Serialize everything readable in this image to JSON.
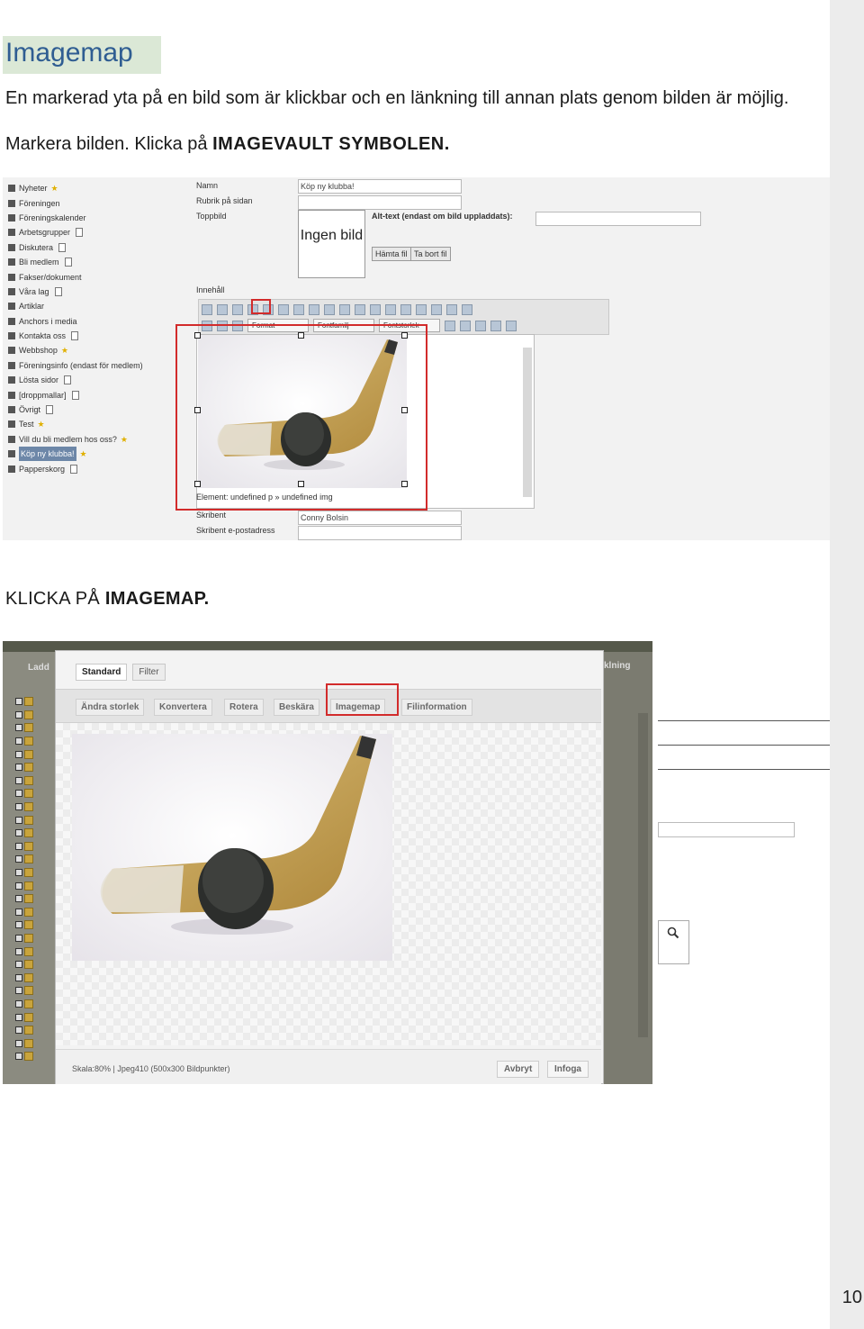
{
  "heading": "Imagemap",
  "para1": "En markerad yta på en bild som är klickbar och en länkning till annan plats genom bilden är möjlig.",
  "para2_prefix": "Markera bilden. Klicka på ",
  "para2_bold": "IMAGEVAULT SYMBOLEN.",
  "para3_prefix": "KLICKA PÅ ",
  "para3_bold": "IMAGEMAP.",
  "page_number": "10",
  "shot1": {
    "tree": [
      {
        "label": "Nyheter",
        "icon": "star"
      },
      {
        "label": "Föreningen",
        "icon": "none"
      },
      {
        "label": "Föreningskalender",
        "icon": "none"
      },
      {
        "label": "Arbetsgrupper",
        "icon": "doc"
      },
      {
        "label": "Diskutera",
        "icon": "doc"
      },
      {
        "label": "Bli medlem",
        "icon": "doc"
      },
      {
        "label": "Fakser/dokument",
        "icon": "none"
      },
      {
        "label": "Våra lag",
        "icon": "doc"
      },
      {
        "label": "Artiklar",
        "icon": "none"
      },
      {
        "label": "Anchors i media",
        "icon": "none"
      },
      {
        "label": "Kontakta oss",
        "icon": "doc"
      },
      {
        "label": "Webbshop",
        "icon": "star"
      },
      {
        "label": "Föreningsinfo (endast för medlem)",
        "icon": "none"
      },
      {
        "label": "Lösta sidor",
        "icon": "doc"
      },
      {
        "label": "[droppmallar]",
        "icon": "doc"
      },
      {
        "label": "Övrigt",
        "icon": "doc"
      },
      {
        "label": "Test",
        "icon": "star"
      },
      {
        "label": "Vill du bli medlem hos oss?",
        "icon": "star"
      },
      {
        "label": "Köp ny klubba!",
        "icon": "star",
        "selected": true
      },
      {
        "label": "Papperskorg",
        "icon": "doc"
      }
    ],
    "labels": {
      "name": "Namn",
      "page_heading": "Rubrik på sidan",
      "top_image": "Toppbild",
      "content": "Innehåll",
      "alt_text": "Alt-text (endast om bild uppladdats):",
      "writer": "Skribent",
      "writer_email": "Skribent e-postadress"
    },
    "values": {
      "name": "Köp ny klubba!",
      "writer": "Conny Bolsin"
    },
    "no_image": "Ingen bild",
    "fetch_button": "Hämta fil",
    "remove_button": "Ta bort fil",
    "toolbar_selects": [
      "Format",
      "Fontfamilj",
      "Fontstorlek"
    ],
    "element_path": "Element: undefined p » undefined img"
  },
  "shot2": {
    "tabs": [
      "Standard",
      "Filter"
    ],
    "buttons": [
      "Ändra storlek",
      "Konvertera",
      "Rotera",
      "Beskära",
      "Imagemap",
      "Filinformation"
    ],
    "footer_status": "Skala:80% | Jpeg410 (500x300 Bildpunkter)",
    "cancel": "Avbryt",
    "insert": "Infoga",
    "side_fragments": [
      "Ladd",
      "klning"
    ]
  },
  "colors": {
    "heading": "#2f5d92",
    "heading_bg": "#dbe8d6",
    "highlight": "#d22b2b"
  }
}
